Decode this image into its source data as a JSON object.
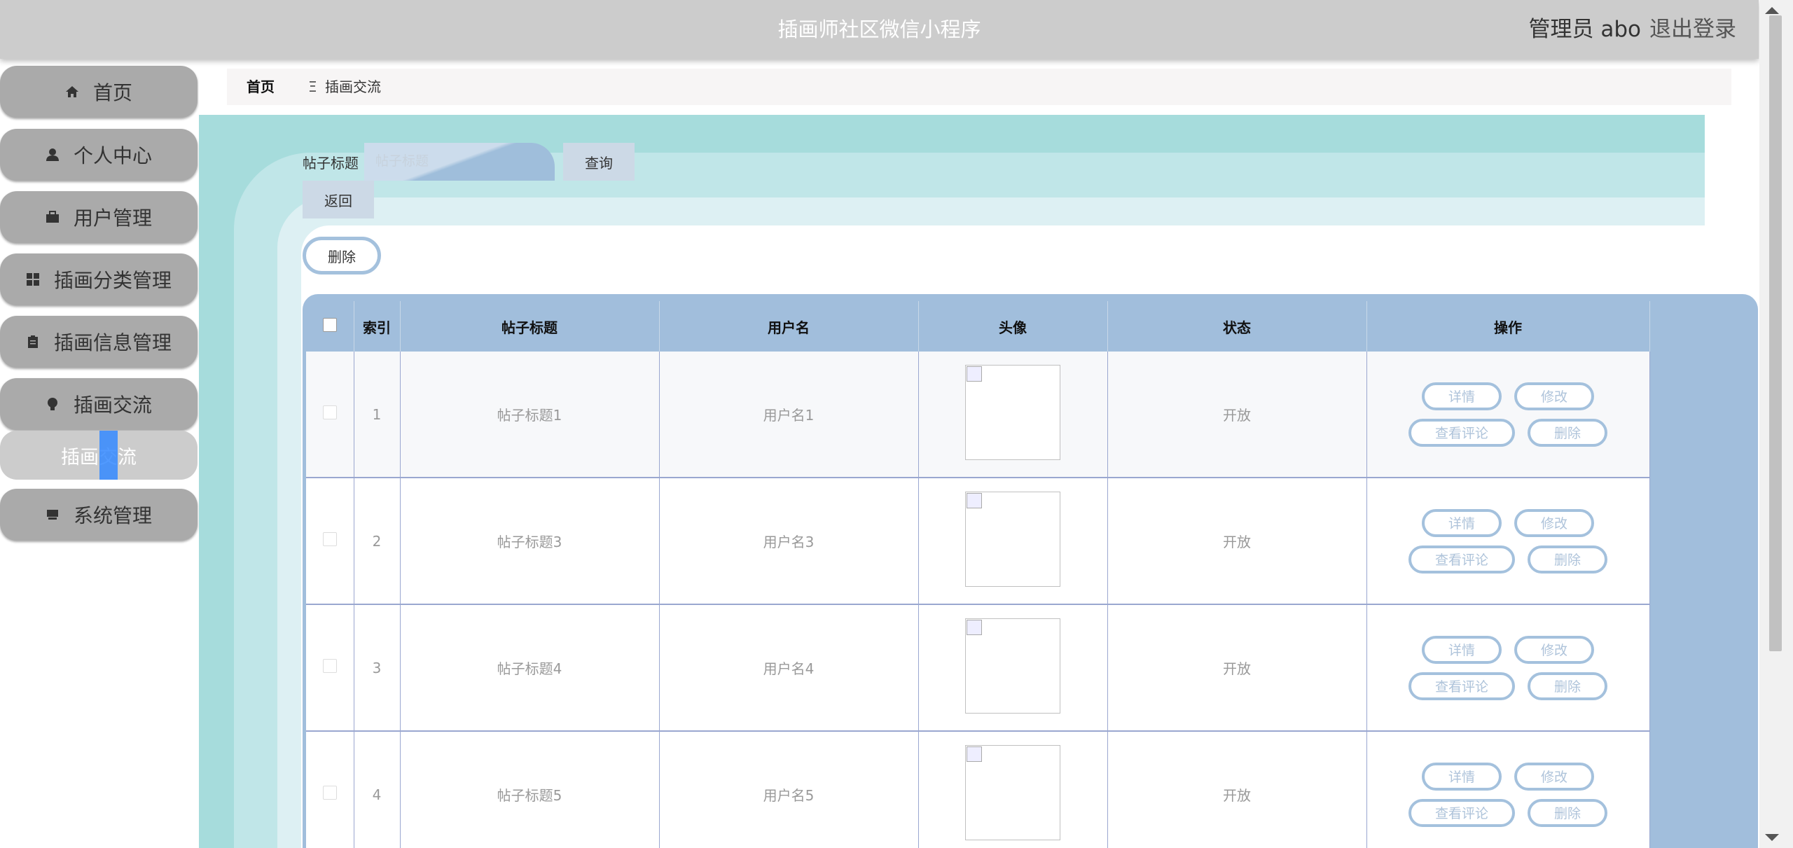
{
  "header": {
    "title": "插画师社区微信小程序",
    "admin_label": "管理员 abo",
    "logout_label": "退出登录"
  },
  "sidebar": {
    "items": [
      {
        "label": "首页",
        "icon": "home-icon"
      },
      {
        "label": "个人中心",
        "icon": "user-icon"
      },
      {
        "label": "用户管理",
        "icon": "briefcase-icon"
      },
      {
        "label": "插画分类管理",
        "icon": "grid-icon"
      },
      {
        "label": "插画信息管理",
        "icon": "clipboard-icon"
      },
      {
        "label": "插画交流",
        "icon": "bulb-icon"
      },
      {
        "label": "系统管理",
        "icon": "drive-icon"
      }
    ],
    "active_submenu": "插画交流"
  },
  "breadcrumb": {
    "home": "首页",
    "separator": "Ξ",
    "current": "插画交流"
  },
  "search": {
    "label": "帖子标题",
    "placeholder": "帖子标题",
    "query_label": "查询",
    "back_label": "返回"
  },
  "toolbar": {
    "delete_label": "删除"
  },
  "table": {
    "columns": [
      "索引",
      "帖子标题",
      "用户名",
      "头像",
      "状态",
      "操作"
    ],
    "rows": [
      {
        "index": "1",
        "title": "帖子标题1",
        "username": "用户名1",
        "status": "开放"
      },
      {
        "index": "2",
        "title": "帖子标题3",
        "username": "用户名3",
        "status": "开放"
      },
      {
        "index": "3",
        "title": "帖子标题4",
        "username": "用户名4",
        "status": "开放"
      },
      {
        "index": "4",
        "title": "帖子标题5",
        "username": "用户名5",
        "status": "开放"
      }
    ],
    "actions": {
      "detail": "详情",
      "edit": "修改",
      "comments": "查看评论",
      "delete": "删除"
    }
  },
  "colors": {
    "header_bg": "#cccccc",
    "menu_bg": "#aaaaaa",
    "teal_band": "#a6dcdc",
    "light_teal": "#c0e6e8",
    "pale_teal": "#ddf0f3",
    "table_header": "#a1bedc",
    "button_border": "#a4c1dd",
    "selection": "#3388ff"
  }
}
